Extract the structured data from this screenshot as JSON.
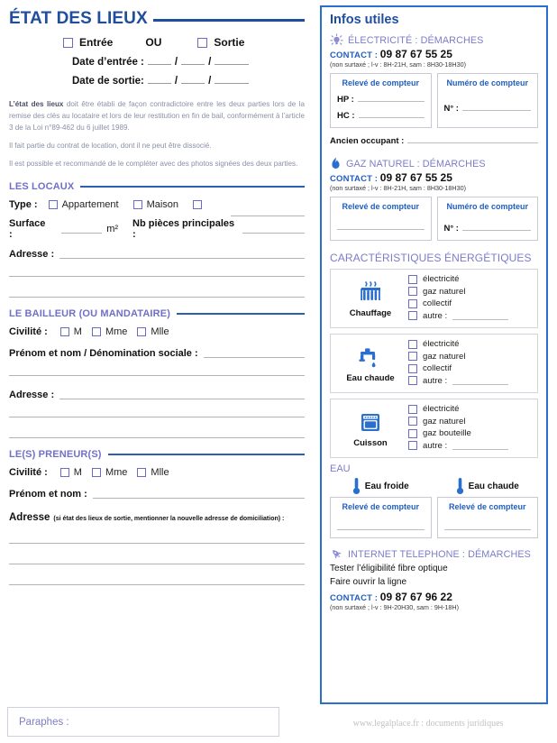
{
  "colors": {
    "title_blue": "#1f4e9c",
    "section_purple": "#7070c8",
    "rule_blue": "#2a5fb4",
    "panel_border": "#2a6fd0",
    "contact_blue": "#1f5fc0",
    "checkbox_border": "#6b6bc4",
    "muted_text": "#8a8fa6"
  },
  "left": {
    "doc_title": "ÉTAT DES LIEUX",
    "entry_exit": {
      "entree_label": "Entrée",
      "or_label": "OU",
      "sortie_label": "Sortie"
    },
    "dates": {
      "entree_label": "Date d’entrée :",
      "sortie_label": "Date de sortie:",
      "separator": "/"
    },
    "legal": {
      "p1_bold": "L’état des lieux",
      "p1": " doit être établi de façon contradictoire entre les deux parties lors de la remise des clés au locataire et lors de leur restitution en fin de bail, conformément à l’article 3 de la Loi n°89-462 du 6 juillet 1989.",
      "p2": "Il fait partie du contrat de location, dont il ne peut être dissocié.",
      "p3": "Il est possible et recommandé de le compléter avec des photos signées des deux parties."
    },
    "locaux": {
      "section_title": "LES LOCAUX",
      "type_label": "Type :",
      "type_options": [
        "Appartement",
        "Maison"
      ],
      "surface_label": "Surface :",
      "surface_unit": "m²",
      "rooms_label": "Nb pièces principales :",
      "address_label": "Adresse :"
    },
    "bailleur": {
      "section_title": "LE BAILLEUR (OU MANDATAIRE)",
      "civilite_label": "Civilité :",
      "civilite_options": [
        "M",
        "Mme",
        "Mlle"
      ],
      "name_label": "Prénom et nom / Dénomination sociale :",
      "address_label": "Adresse :"
    },
    "preneurs": {
      "section_title": "LE(S) PRENEUR(S)",
      "civilite_label": "Civilité :",
      "civilite_options": [
        "M",
        "Mme",
        "Mlle"
      ],
      "name_label": "Prénom et nom :",
      "address_label": "Adresse",
      "address_note": "(si état des lieux de sortie, mentionner la nouvelle adresse de domiciliation) :"
    },
    "paraphes_label": "Paraphes :"
  },
  "footer": {
    "credit": "www.legalplace.fr : documents juridiques"
  },
  "right": {
    "panel_title": "Infos utiles",
    "electricite": {
      "icon": "lightbulb-icon",
      "heading": "ÉLECTRICITÉ : DÉMARCHES",
      "contact_label": "CONTACT",
      "contact_sep": ":",
      "phone": "09 87 67 55 25",
      "hours": "(non surtaxé ; l-v : 8H-21H, sam : 8H30-18H30)",
      "meter_reading_title": "Relevé de compteur",
      "meter_number_title": "Numéro de compteur",
      "hp_label": "HP :",
      "hc_label": "HC :",
      "number_label": "N° :",
      "ancien_label": "Ancien occupant :"
    },
    "gaz": {
      "icon": "flame-icon",
      "heading": "GAZ NATUREL : DÉMARCHES",
      "contact_label": "CONTACT",
      "contact_sep": ":",
      "phone": "09 87 67 55 25",
      "hours": "(non surtaxé ; l-v : 8H-21H, sam : 8H30-18H30)",
      "meter_reading_title": "Relevé de compteur",
      "meter_number_title": "Numéro de compteur",
      "number_label": "N° :"
    },
    "caracteristiques": {
      "title": "CARACTÉRISTIQUES ÉNERGÉTIQUES",
      "items": [
        {
          "icon": "radiator-icon",
          "label": "Chauffage",
          "options": [
            "électricité",
            "gaz naturel",
            "collectif",
            "autre :"
          ]
        },
        {
          "icon": "faucet-icon",
          "label": "Eau chaude",
          "options": [
            "électricité",
            "gaz naturel",
            "collectif",
            "autre :"
          ]
        },
        {
          "icon": "oven-icon",
          "label": "Cuisson",
          "options": [
            "électricité",
            "gaz naturel",
            "gaz bouteille",
            "autre :"
          ]
        }
      ]
    },
    "eau": {
      "title": "EAU",
      "cold": {
        "icon": "thermometer-icon",
        "label": "Eau froide",
        "box_title": "Relevé de compteur"
      },
      "hot": {
        "icon": "thermometer-icon",
        "label": "Eau chaude",
        "box_title": "Relevé de compteur"
      }
    },
    "internet": {
      "icon": "rocket-icon",
      "heading": "INTERNET TELEPHONE : DÉMARCHES",
      "line1": "Tester l’éligibilité fibre optique",
      "line2": "Faire ouvrir la ligne",
      "contact_label": "CONTACT",
      "contact_sep": ":",
      "phone": "09 87 67 96 22",
      "hours": "(non surtaxé ; l-v : 9H-20H30, sam : 9H-18H)"
    }
  }
}
